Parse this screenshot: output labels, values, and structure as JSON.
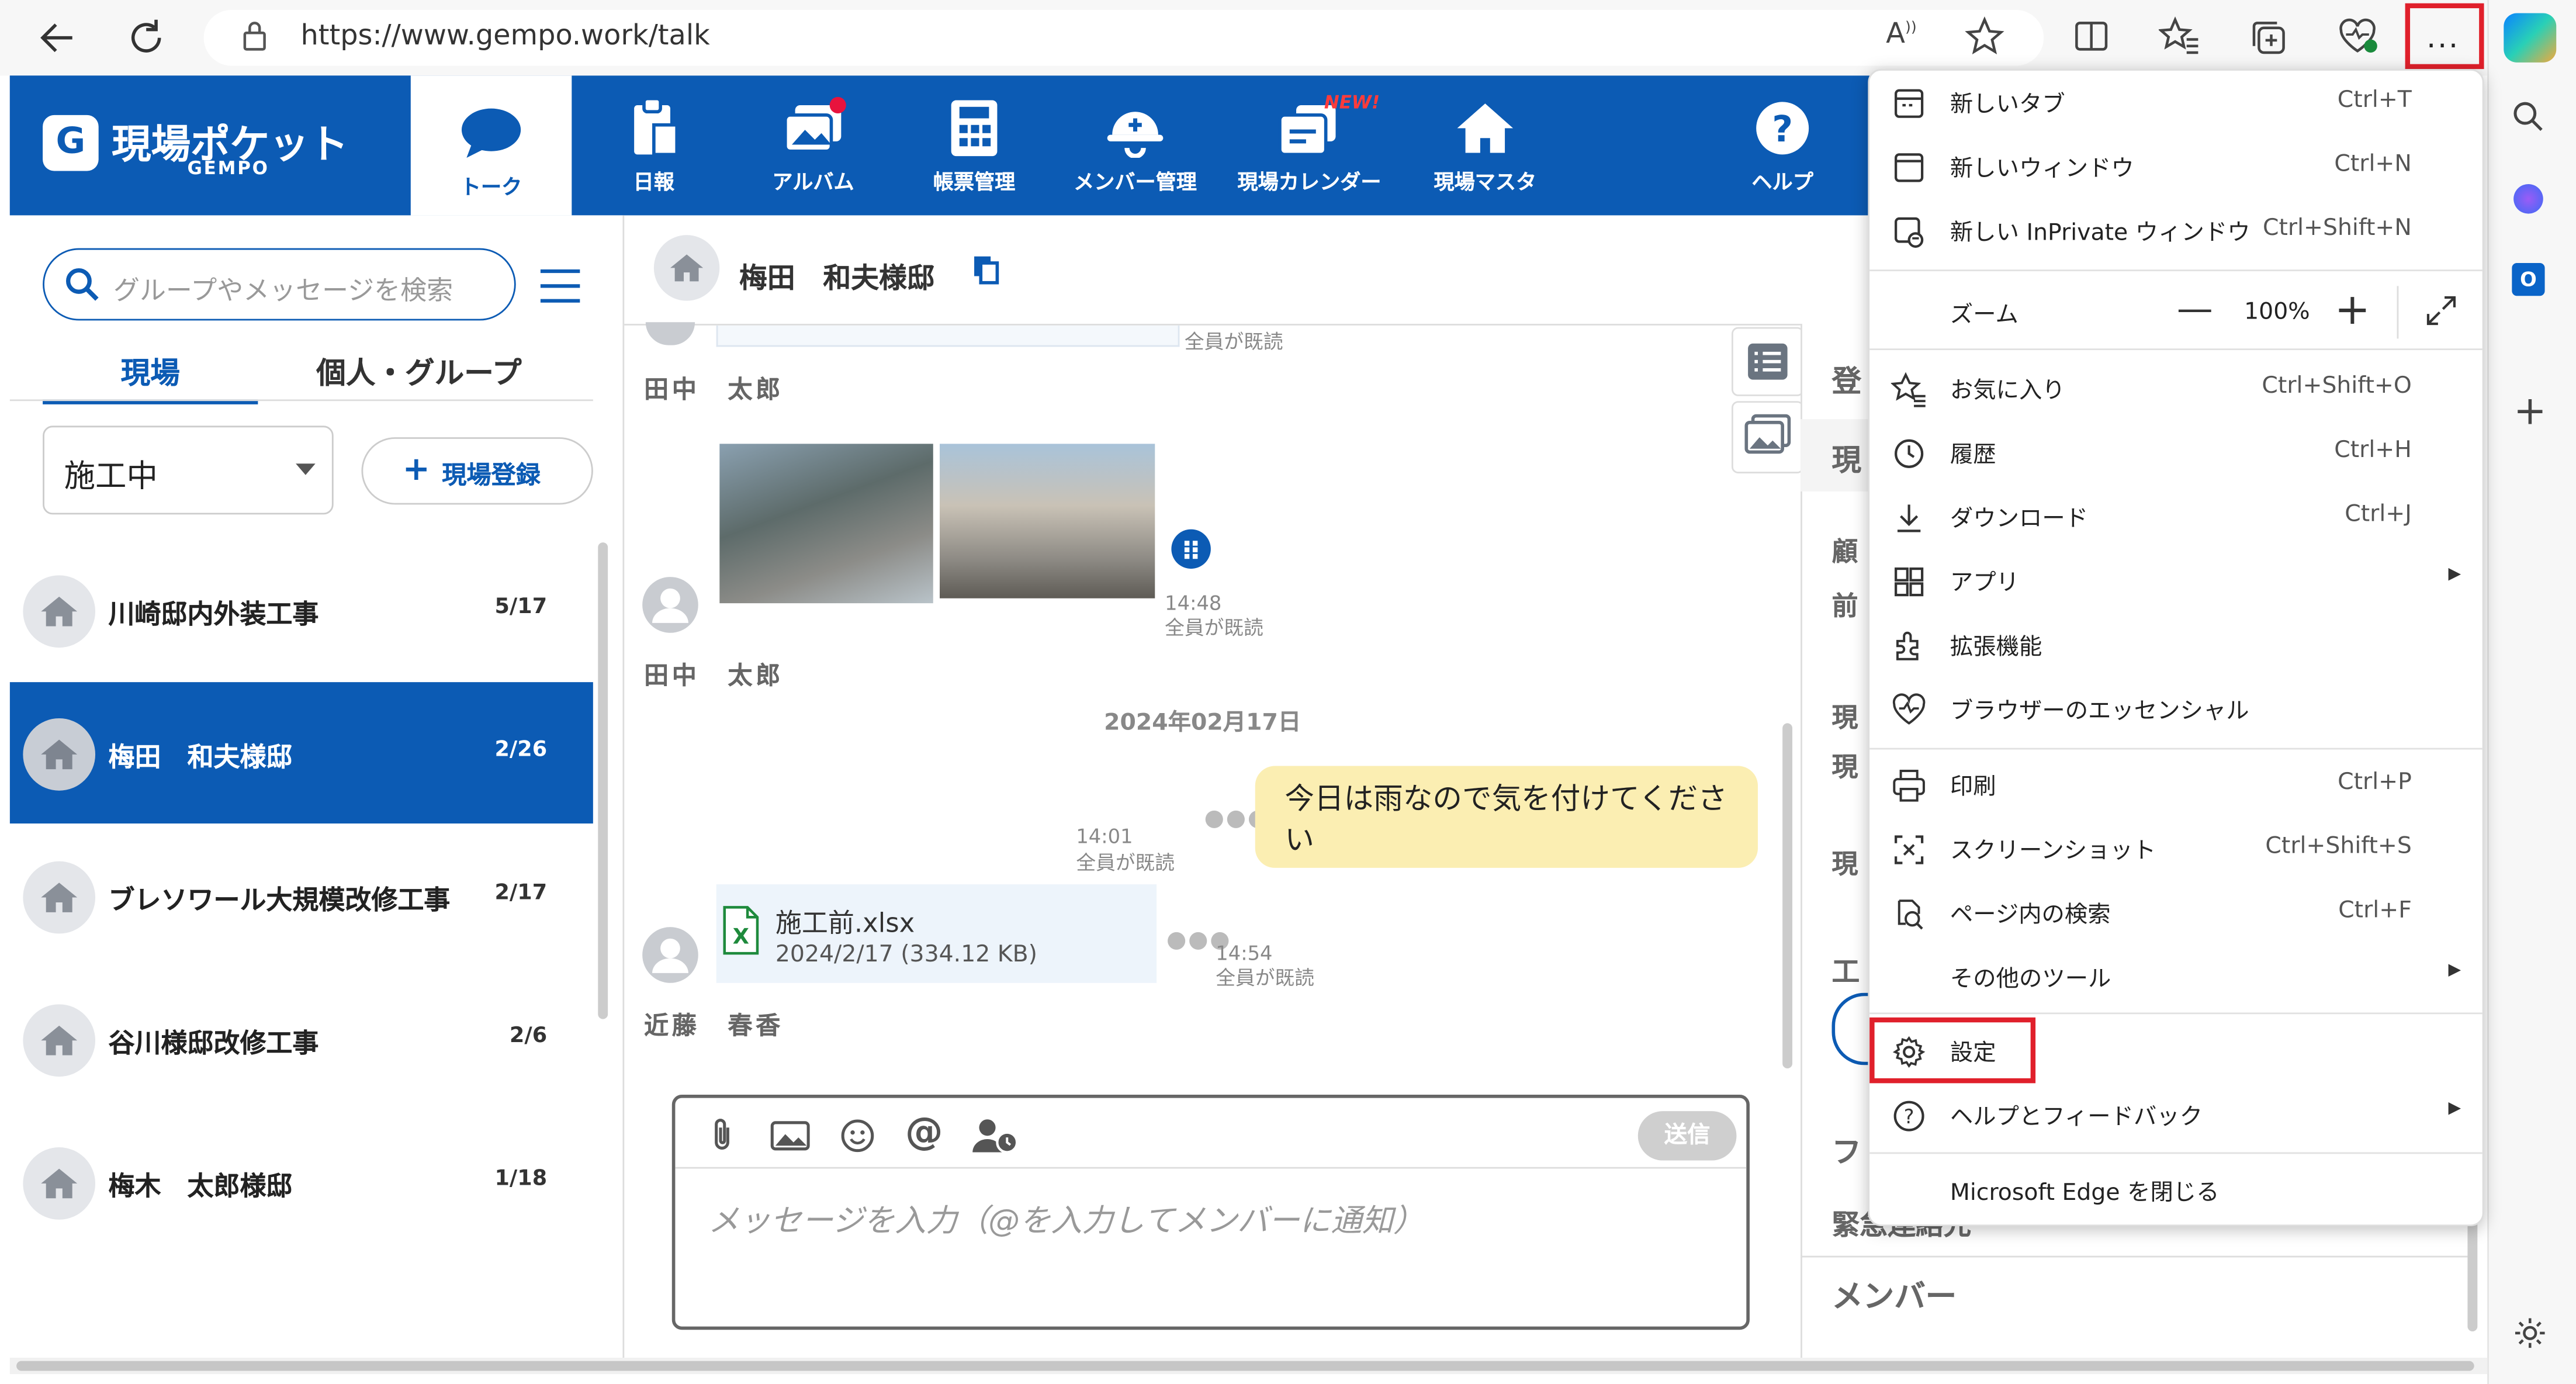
{
  "browser": {
    "url": "https://www.gempo.work/talk"
  },
  "app": {
    "logo_text": "現場ポケット",
    "logo_sub": "GEMPO",
    "nav": [
      {
        "label": "トーク"
      },
      {
        "label": "日報"
      },
      {
        "label": "アルバム"
      },
      {
        "label": "帳票管理"
      },
      {
        "label": "メンバー管理"
      },
      {
        "label": "現場カレンダー",
        "badge": "NEW!"
      },
      {
        "label": "現場マスタ"
      },
      {
        "label": "ヘルプ"
      }
    ]
  },
  "left": {
    "search_placeholder": "グループやメッセージを検索",
    "tab_site": "現場",
    "tab_group": "個人・グループ",
    "filter_value": "施工中",
    "register_button": "現場登録",
    "sites": [
      {
        "name": "川崎邸内外装工事",
        "count": "5/17"
      },
      {
        "name": "梅田　和夫様邸",
        "count": "2/26"
      },
      {
        "name": "ブレソワール大規模改修工事",
        "count": "2/17"
      },
      {
        "name": "谷川様邸改修工事",
        "count": "2/6"
      },
      {
        "name": "梅木　太郎様邸",
        "count": "1/18"
      }
    ]
  },
  "chat": {
    "title": "梅田　和夫様邸",
    "read_all_top": "全員が既読",
    "sender1": "田中　太郎",
    "photo_time": "14:48",
    "photo_read": "全員が既読",
    "sender2": "田中　太郎",
    "date_divider": "2024年02月17日",
    "my_time": "14:01",
    "my_read": "全員が既読",
    "my_message": "今日は雨なので気を付けてください",
    "file_name": "施工前.xlsx",
    "file_info": "2024/2/17 (334.12 KB)",
    "file_time": "14:54",
    "file_read": "全員が既読",
    "sender3": "近藤　春香",
    "input_placeholder": "メッセージを入力（@を入力してメンバーに通知）",
    "send_button": "送信"
  },
  "rightpanel": {
    "labels": [
      "登",
      "現",
      "顧",
      "前",
      "現",
      "現",
      "現",
      "工",
      "フ",
      "緊急連絡先"
    ],
    "members": "メンバー"
  },
  "menu": {
    "items": [
      {
        "label": "新しいタブ",
        "shortcut": "Ctrl+T",
        "icon": "new-tab-icon"
      },
      {
        "label": "新しいウィンドウ",
        "shortcut": "Ctrl+N",
        "icon": "new-window-icon"
      },
      {
        "label": "新しい InPrivate ウィンドウ",
        "shortcut": "Ctrl+Shift+N",
        "icon": "inprivate-icon"
      },
      {
        "label": "お気に入り",
        "shortcut": "Ctrl+Shift+O",
        "icon": "favorites-icon"
      },
      {
        "label": "履歴",
        "shortcut": "Ctrl+H",
        "icon": "history-icon"
      },
      {
        "label": "ダウンロード",
        "shortcut": "Ctrl+J",
        "icon": "download-icon"
      },
      {
        "label": "アプリ",
        "shortcut": "",
        "icon": "apps-icon"
      },
      {
        "label": "拡張機能",
        "shortcut": "",
        "icon": "extensions-icon"
      },
      {
        "label": "ブラウザーのエッセンシャル",
        "shortcut": "",
        "icon": "essentials-icon"
      },
      {
        "label": "印刷",
        "shortcut": "Ctrl+P",
        "icon": "print-icon"
      },
      {
        "label": "スクリーンショット",
        "shortcut": "Ctrl+Shift+S",
        "icon": "screenshot-icon"
      },
      {
        "label": "ページ内の検索",
        "shortcut": "Ctrl+F",
        "icon": "find-icon"
      },
      {
        "label": "その他のツール",
        "shortcut": "",
        "icon": ""
      },
      {
        "label": "設定",
        "shortcut": "",
        "icon": "settings-icon"
      },
      {
        "label": "ヘルプとフィードバック",
        "shortcut": "",
        "icon": "help-icon"
      },
      {
        "label": "Microsoft Edge を閉じる",
        "shortcut": "",
        "icon": ""
      }
    ],
    "zoom_label": "ズーム",
    "zoom_value": "100%"
  },
  "colors": {
    "brand": "#0c5bb4",
    "highlight": "#e0202b",
    "bubble": "#fbeeb2"
  }
}
